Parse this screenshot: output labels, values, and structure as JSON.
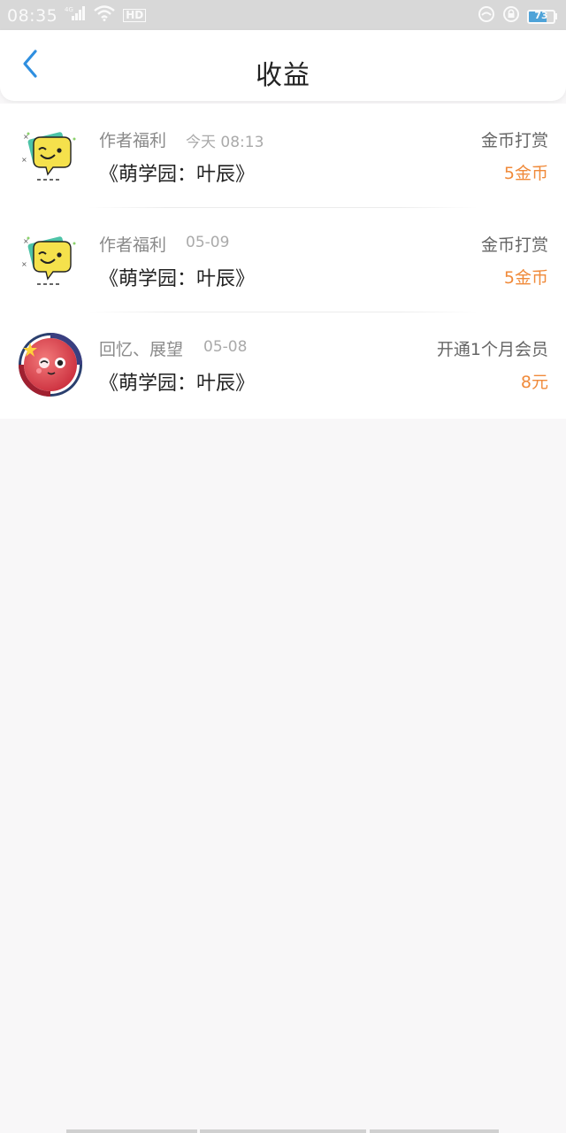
{
  "status_bar": {
    "time": "08:35",
    "network_label": "4G",
    "hd_label": "HD",
    "battery_level": "73",
    "battery_fraction": 0.73
  },
  "header": {
    "title": "收益",
    "back_icon": "chevron-left-icon"
  },
  "earnings": [
    {
      "source": "作者福利",
      "date": "今天 08:13",
      "book": "《萌学园：叶辰》",
      "type": "金币打赏",
      "amount": "5金币",
      "avatar": "chat-bubble-avatar"
    },
    {
      "source": "作者福利",
      "date": "05-09",
      "book": "《萌学园：叶辰》",
      "type": "金币打赏",
      "amount": "5金币",
      "avatar": "chat-bubble-avatar"
    },
    {
      "source": "回忆、展望",
      "date": "05-08",
      "book": "《萌学园：叶辰》",
      "type": "开通1个月会员",
      "amount": "8元",
      "avatar": "badge-avatar"
    }
  ],
  "colors": {
    "accent_blue": "#2f8fe0",
    "amount_orange": "#f08a3a",
    "status_bar_bg": "#d8d8d8",
    "page_bg": "#f8f7f8"
  }
}
